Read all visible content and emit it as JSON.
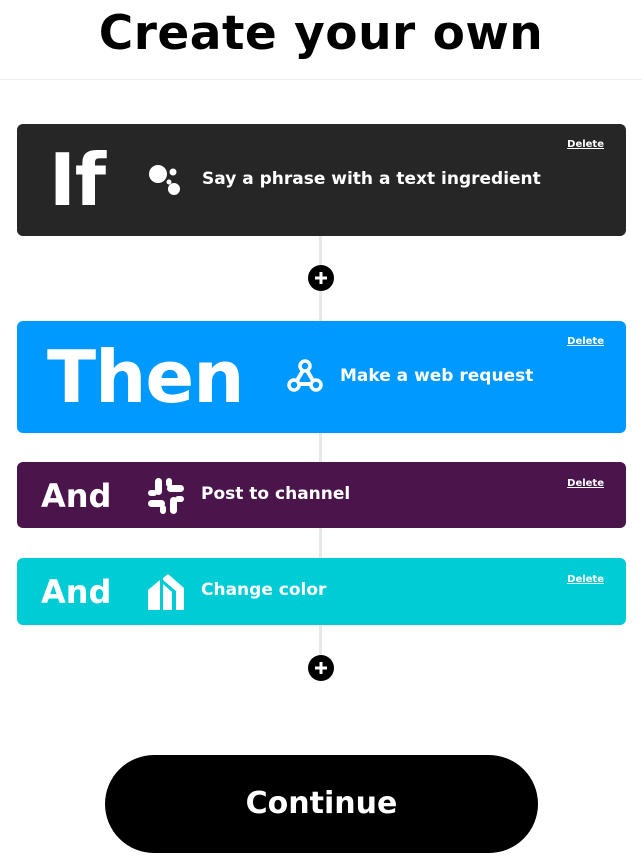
{
  "header": {
    "title": "Create your own"
  },
  "applet": {
    "trigger": {
      "keyword": "If",
      "action": "Say a phrase with a text ingredient",
      "delete_label": "Delete",
      "service_icon": "google-assistant-icon",
      "color": "#262626"
    },
    "actions": [
      {
        "keyword": "Then",
        "action": "Make a web request",
        "delete_label": "Delete",
        "service_icon": "webhooks-icon",
        "color": "#0099ff"
      },
      {
        "keyword": "And",
        "action": "Post to channel",
        "delete_label": "Delete",
        "service_icon": "slack-icon",
        "color": "#4a154b"
      },
      {
        "keyword": "And",
        "action": "Change color",
        "delete_label": "Delete",
        "service_icon": "kasa-icon",
        "color": "#00ccd6"
      }
    ],
    "add_icons": [
      "plus-icon",
      "plus-icon"
    ]
  },
  "footer": {
    "continue_label": "Continue"
  }
}
